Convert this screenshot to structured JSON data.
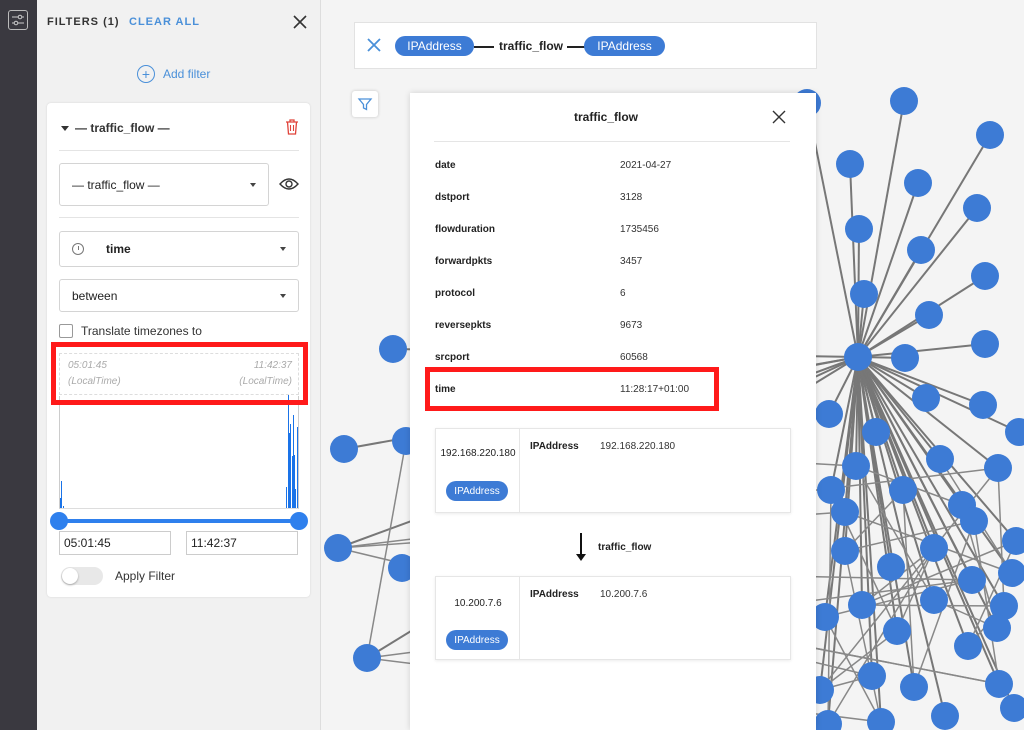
{
  "colors": {
    "accent": "#4a90d9",
    "node": "#3d7bd5",
    "highlight": "#ff1a1a",
    "histogram": "#1a73e8"
  },
  "filters": {
    "header": "FILTERS (1)",
    "clear_all": "CLEAR ALL",
    "add_filter": "Add filter",
    "card": {
      "title": "— traffic_flow —",
      "edge_type_select": "— traffic_flow —",
      "property_select": "time",
      "operator_select": "between",
      "translate_label": "Translate timezones to",
      "range_from": "05:01:45",
      "range_from_zone": "(LocalTime)",
      "range_to": "11:42:37",
      "range_to_zone": "(LocalTime)",
      "from_input": "05:01:45",
      "to_input": "11:42:37",
      "apply_label": "Apply Filter",
      "apply_enabled": false
    }
  },
  "histogram": {
    "bins": [
      0.09,
      0.24,
      0.02,
      0,
      0,
      0,
      0,
      0,
      0,
      0,
      0,
      0,
      0,
      0,
      0,
      0,
      0,
      0,
      0,
      0,
      0,
      0,
      0,
      0,
      0,
      0,
      0,
      0,
      0,
      0,
      0,
      0,
      0,
      0,
      0,
      0,
      0,
      0,
      0,
      0,
      0,
      0,
      0,
      0,
      0,
      0,
      0,
      0,
      0,
      0,
      0,
      0,
      0,
      0,
      0,
      0,
      0,
      0,
      0,
      0,
      0,
      0,
      0,
      0,
      0,
      0,
      0,
      0,
      0,
      0,
      0,
      0,
      0,
      0,
      0,
      0,
      0,
      0,
      0,
      0,
      0,
      0,
      0,
      0,
      0,
      0,
      0,
      0,
      0,
      0,
      0,
      0,
      0,
      0,
      0,
      0,
      0,
      0,
      0,
      0,
      0,
      0,
      0,
      0,
      0,
      0,
      0,
      0,
      0,
      0,
      0,
      0,
      0,
      0,
      0,
      0,
      0,
      0,
      0,
      0,
      0,
      0,
      0,
      0,
      0,
      0,
      0,
      0,
      0,
      0,
      0,
      0,
      0,
      0,
      0,
      0,
      0,
      0,
      0,
      0,
      0,
      0,
      0,
      0,
      0,
      0,
      0,
      0,
      0,
      0,
      0,
      0,
      0,
      0,
      0,
      0,
      0,
      0,
      0,
      0,
      0,
      0,
      0,
      0,
      0,
      0,
      0,
      0,
      0,
      0,
      0,
      0,
      0,
      0,
      0,
      0,
      0,
      0.19,
      1.0,
      0.66,
      0.74,
      0.46,
      0.82,
      0.47,
      0.17,
      0.72
    ]
  },
  "query": {
    "from_node": "IPAddress",
    "edge": "traffic_flow",
    "to_node": "IPAddress"
  },
  "popup": {
    "title": "traffic_flow",
    "properties": [
      {
        "key": "date",
        "value": "2021-04-27"
      },
      {
        "key": "dstport",
        "value": "3128"
      },
      {
        "key": "flowduration",
        "value": "1735456"
      },
      {
        "key": "forwardpkts",
        "value": "3457"
      },
      {
        "key": "protocol",
        "value": "6"
      },
      {
        "key": "reversepkts",
        "value": "9673"
      },
      {
        "key": "srcport",
        "value": "60568"
      },
      {
        "key": "time",
        "value": "11:28:17+01:00"
      }
    ],
    "source": {
      "ip": "192.168.220.180",
      "type": "IPAddress",
      "prop_key": "IPAddress",
      "prop_value": "192.168.220.180"
    },
    "edge_label": "traffic_flow",
    "target": {
      "ip": "10.200.7.6",
      "type": "IPAddress",
      "prop_key": "IPAddress",
      "prop_value": "10.200.7.6"
    }
  }
}
